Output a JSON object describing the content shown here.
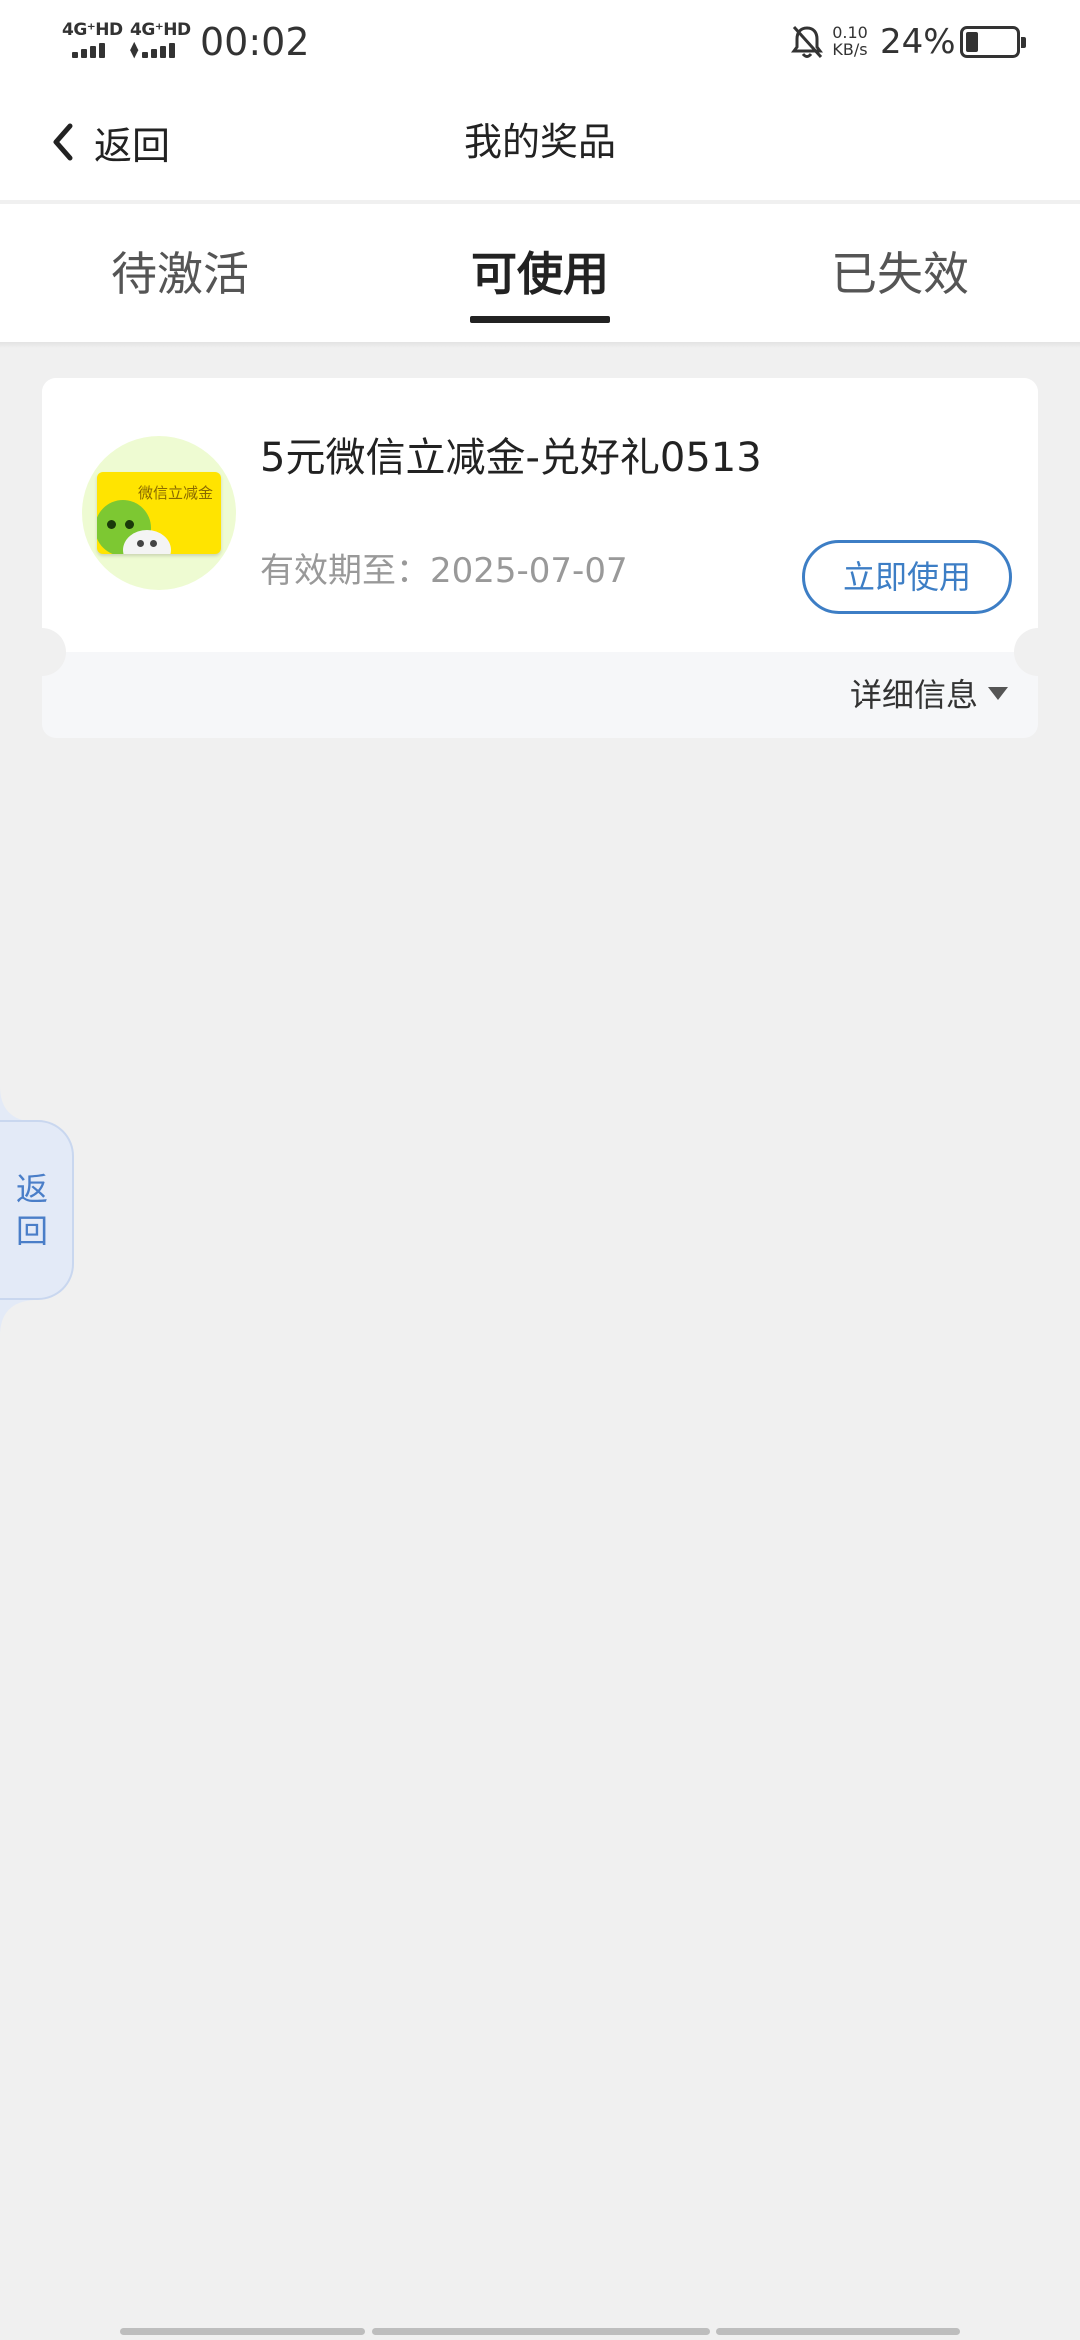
{
  "status_bar": {
    "network_1": "4G⁺HD",
    "network_2": "4G⁺HD",
    "time": "00:02",
    "speed_value": "0.10",
    "speed_unit": "KB/s",
    "battery": "24%",
    "battery_level_percent": 24
  },
  "nav": {
    "back_label": "返回",
    "title": "我的奖品"
  },
  "tabs": [
    {
      "label": "待激活",
      "active": false
    },
    {
      "label": "可使用",
      "active": true
    },
    {
      "label": "已失效",
      "active": false
    }
  ],
  "prize": {
    "thumb_text": "微信立减金",
    "name": "5元微信立减金-兑好礼0513",
    "expiry": "有效期至：2025-07-07",
    "use_label": "立即使用",
    "detail_label": "详细信息"
  },
  "float_back": {
    "label_1": "返",
    "label_2": "回"
  },
  "colors": {
    "accent_blue": "#3d7ec5",
    "page_bg": "#f0f0f0",
    "voucher_yellow": "#ffe400",
    "thumb_bg": "#eefbd2"
  }
}
